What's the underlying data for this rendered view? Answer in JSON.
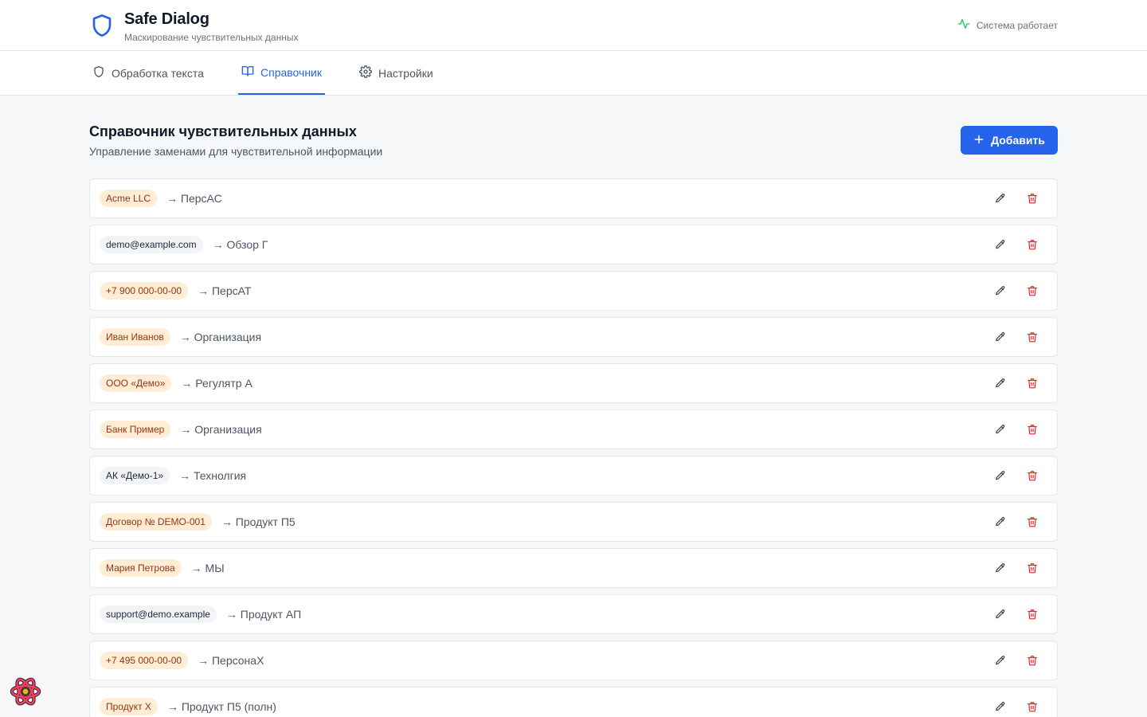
{
  "header": {
    "title": "Safe Dialog",
    "subtitle": "Маскирование чувствительных данных",
    "status": "Система работает",
    "logo_icon": "shield-icon",
    "status_icon": "activity-icon"
  },
  "tabs": [
    {
      "label": "Обработка текста",
      "icon": "shield-icon",
      "active": false
    },
    {
      "label": "Справочник",
      "icon": "book-icon",
      "active": true
    },
    {
      "label": "Настройки",
      "icon": "gear-icon",
      "active": false
    }
  ],
  "page": {
    "title": "Справочник чувствительных данных",
    "subtitle": "Управление заменами для чувствительной информации",
    "add_label": "Добавить"
  },
  "colors": {
    "accent": "#2563eb",
    "badge_orange_bg": "#ffedd5",
    "badge_orange_text": "#9a3412",
    "badge_gray_bg": "#f3f4f6",
    "delete": "#dc2626",
    "status": "#22c55e"
  },
  "entries": [
    {
      "original": "Acme LLC",
      "replacement": "→ ПерсАС",
      "style": "orange"
    },
    {
      "original": "demo@example.com",
      "replacement": "→ Обзор Г",
      "style": "gray"
    },
    {
      "original": "+7 900 000-00-00",
      "replacement": "→ ПерсАТ",
      "style": "orange"
    },
    {
      "original": "Иван Иванов",
      "replacement": "→ Организация",
      "style": "orange"
    },
    {
      "original": "ООО «Демо»",
      "replacement": "→ Регулятр А",
      "style": "orange"
    },
    {
      "original": "Банк Пример",
      "replacement": "→ Организация",
      "style": "orange"
    },
    {
      "original": "АК «Демо-1»",
      "replacement": "→ Технолгия",
      "style": "gray"
    },
    {
      "original": "Договор № DEMO-001",
      "replacement": "→ Продукт П5",
      "style": "orange"
    },
    {
      "original": "Мария Петрова",
      "replacement": "→ МЫ",
      "style": "orange"
    },
    {
      "original": "support@demo.example",
      "replacement": "→ Продукт АП",
      "style": "gray"
    },
    {
      "original": "+7 495 000-00-00",
      "replacement": "→ ПерсонаХ",
      "style": "orange"
    },
    {
      "original": "Продукт X",
      "replacement": "→ Продукт П5 (полн)",
      "style": "orange"
    }
  ]
}
